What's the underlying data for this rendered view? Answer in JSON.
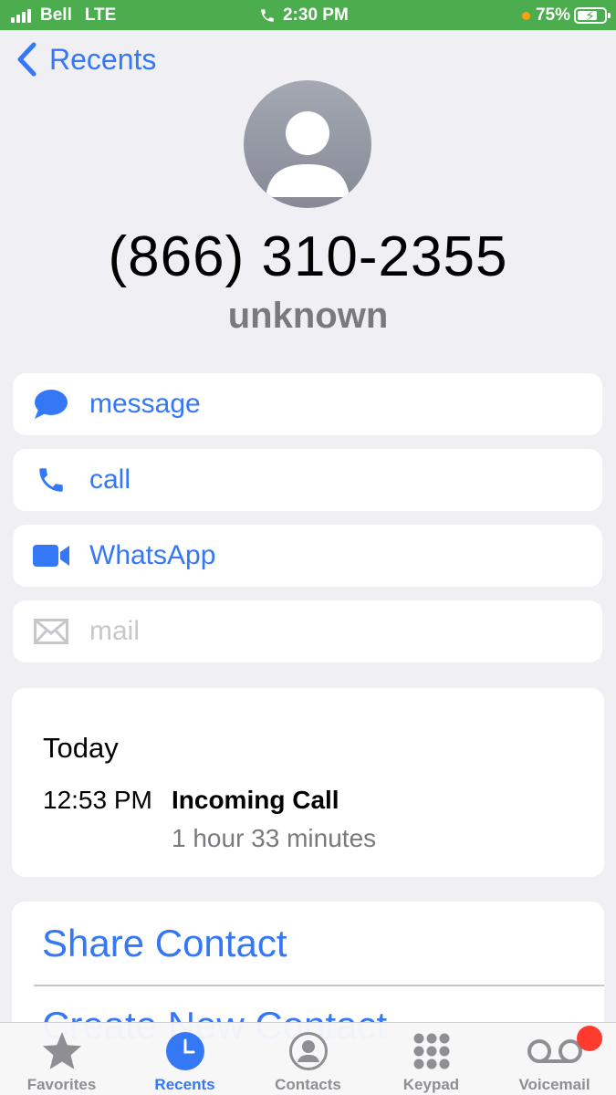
{
  "status": {
    "carrier": "Bell",
    "network": "LTE",
    "time": "2:30 PM",
    "battery": "75%",
    "battery_level": 0.75,
    "bar_color": "#4cad4f"
  },
  "nav": {
    "back_label": "Recents"
  },
  "contact": {
    "phone": "(866) 310-2355",
    "label": "unknown"
  },
  "actions": [
    {
      "label": "message",
      "icon": "message-bubble-icon",
      "enabled": true
    },
    {
      "label": "call",
      "icon": "phone-icon",
      "enabled": true
    },
    {
      "label": "WhatsApp",
      "icon": "video-camera-icon",
      "enabled": true
    },
    {
      "label": "mail",
      "icon": "envelope-icon",
      "enabled": false
    }
  ],
  "history": {
    "day": "Today",
    "time": "12:53 PM",
    "type": "Incoming Call",
    "duration": "1 hour 33 minutes"
  },
  "contact_actions": {
    "share": "Share Contact",
    "create": "Create New Contact"
  },
  "tabs": [
    {
      "label": "Favorites",
      "icon": "star-icon",
      "active": false
    },
    {
      "label": "Recents",
      "icon": "clock-icon",
      "active": true
    },
    {
      "label": "Contacts",
      "icon": "person-circle-icon",
      "active": false
    },
    {
      "label": "Keypad",
      "icon": "keypad-icon",
      "active": false
    },
    {
      "label": "Voicemail",
      "icon": "voicemail-icon",
      "active": false
    }
  ],
  "colors": {
    "accent": "#3478f6",
    "background": "#efeff4",
    "secondary_text": "#7a7a7e",
    "badge": "#ff3b30"
  }
}
